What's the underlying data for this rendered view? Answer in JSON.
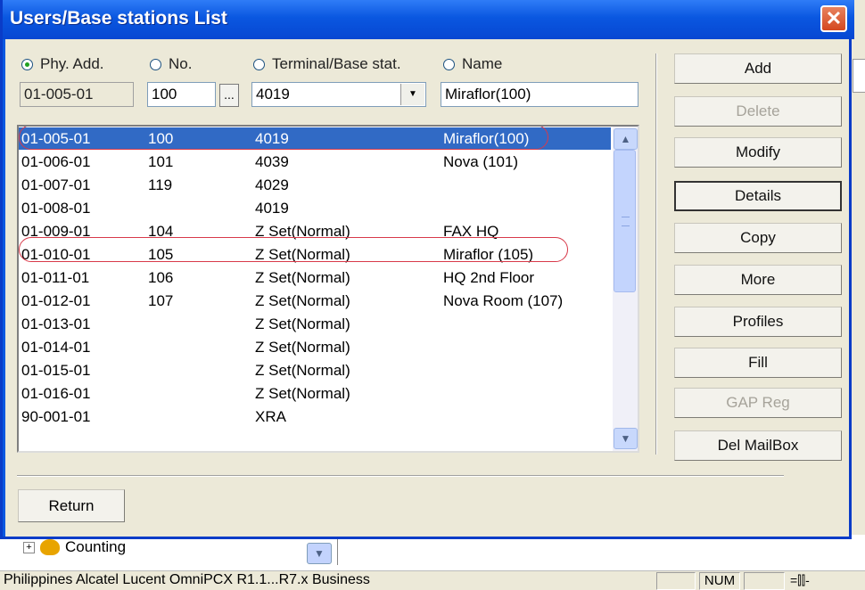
{
  "window": {
    "title": "Users/Base stations List",
    "close_glyph": "✕"
  },
  "filters": {
    "radios": [
      {
        "label": "Phy. Add.",
        "checked": true
      },
      {
        "label": "No.",
        "checked": false
      },
      {
        "label": "Terminal/Base stat.",
        "checked": false
      },
      {
        "label": "Name",
        "checked": false
      }
    ],
    "phy_add_value": "01-005-01",
    "no_value": "100",
    "browse_label": "...",
    "terminal_value": "4019",
    "name_value": "Miraflor(100)"
  },
  "list": {
    "rows": [
      {
        "addr": "01-005-01",
        "no": "100",
        "terminal": "4019",
        "name": "Miraflor(100)",
        "selected": true
      },
      {
        "addr": "01-006-01",
        "no": "101",
        "terminal": "4039",
        "name": "Nova (101)"
      },
      {
        "addr": "01-007-01",
        "no": "119",
        "terminal": "4029",
        "name": ""
      },
      {
        "addr": "01-008-01",
        "no": "",
        "terminal": "4019",
        "name": ""
      },
      {
        "addr": "01-009-01",
        "no": "104",
        "terminal": "Z Set(Normal)",
        "name": "FAX HQ"
      },
      {
        "addr": "01-010-01",
        "no": "105",
        "terminal": "Z Set(Normal)",
        "name": "Miraflor (105)"
      },
      {
        "addr": "01-011-01",
        "no": "106",
        "terminal": "Z Set(Normal)",
        "name": "HQ 2nd Floor"
      },
      {
        "addr": "01-012-01",
        "no": "107",
        "terminal": "Z Set(Normal)",
        "name": "Nova Room (107)"
      },
      {
        "addr": "01-013-01",
        "no": "",
        "terminal": "Z Set(Normal)",
        "name": ""
      },
      {
        "addr": "01-014-01",
        "no": "",
        "terminal": "Z Set(Normal)",
        "name": ""
      },
      {
        "addr": "01-015-01",
        "no": "",
        "terminal": "Z Set(Normal)",
        "name": ""
      },
      {
        "addr": "01-016-01",
        "no": "",
        "terminal": "Z Set(Normal)",
        "name": ""
      },
      {
        "addr": "90-001-01",
        "no": "",
        "terminal": "XRA",
        "name": ""
      }
    ]
  },
  "actions": [
    {
      "label": "Add",
      "enabled": true
    },
    {
      "label": "Delete",
      "enabled": false
    },
    {
      "label": "Modify",
      "enabled": true
    },
    {
      "label": "Details",
      "enabled": true,
      "focused": true
    },
    {
      "label": "Copy",
      "enabled": true
    },
    {
      "label": "More",
      "enabled": true
    },
    {
      "label": "Profiles",
      "enabled": true
    },
    {
      "label": "Fill",
      "enabled": true
    },
    {
      "label": "GAP Reg",
      "enabled": false
    },
    {
      "label": "Del MailBox",
      "enabled": true
    }
  ],
  "return_label": "Return",
  "background": {
    "tree_item": "Counting",
    "status_text": "Philippines Alcatel Lucent OmniPCX R1.1...R7.x Business",
    "status_num": "NUM"
  },
  "colors": {
    "selection": "#316ac5",
    "titlebar": "#0a57e0",
    "annotation": "#d83a4a"
  }
}
